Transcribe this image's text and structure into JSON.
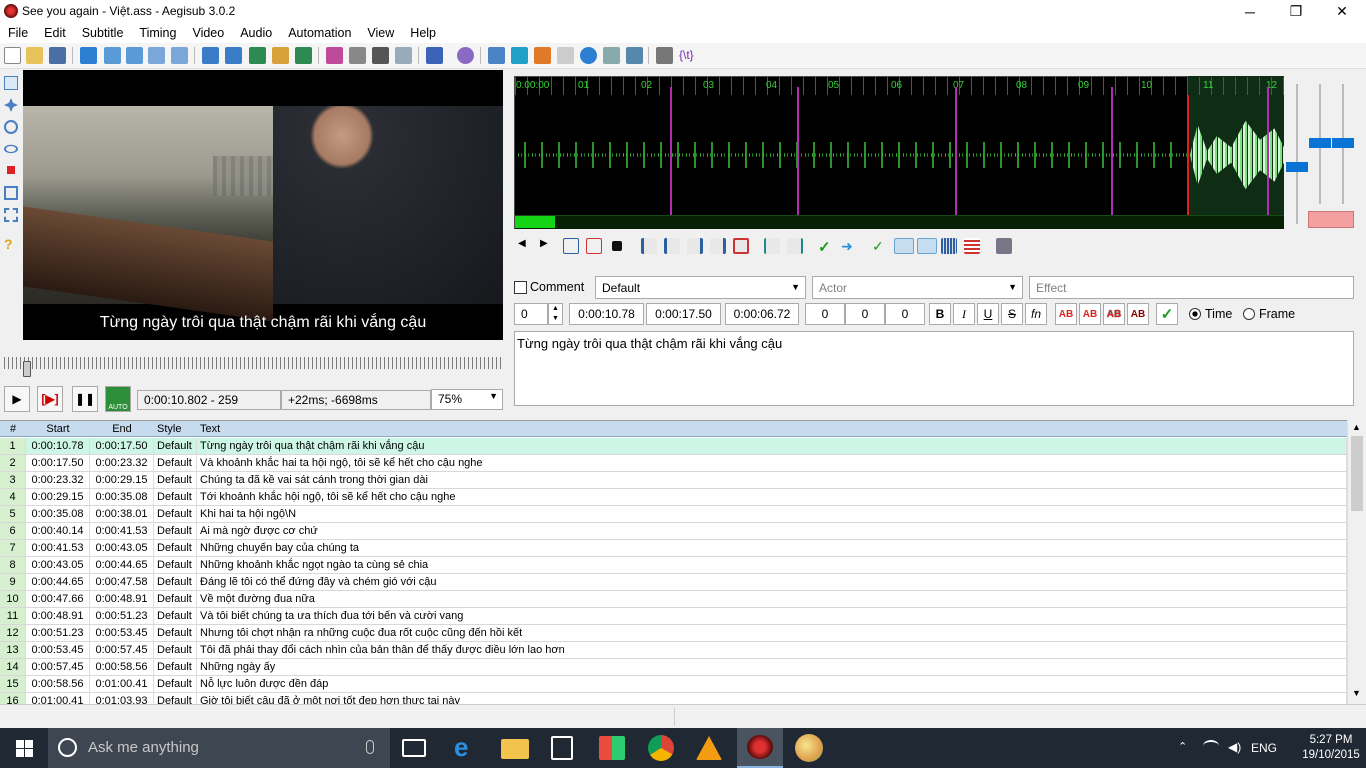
{
  "window": {
    "title": "See you again - Việt.ass - Aegisub 3.0.2",
    "minimize_glyph": "─",
    "maximize_glyph": "❐",
    "close_glyph": "✕"
  },
  "menu": [
    "File",
    "Edit",
    "Subtitle",
    "Timing",
    "Video",
    "Audio",
    "Automation",
    "View",
    "Help"
  ],
  "video": {
    "subtitle_overlay": "Từng ngày trôi qua thật chậm rãi khi vắng cậu",
    "time_display": "0:00:10.802 - 259",
    "offset_display": "+22ms; -6698ms",
    "zoom": "75%",
    "play_glyph": "▶",
    "play_line_glyph": "[▶]",
    "pause_glyph": "❚❚",
    "auto_label": "AUTO"
  },
  "audio": {
    "ticks": [
      "0:00:00",
      "01",
      "02",
      "03",
      "04",
      "05",
      "06",
      "07",
      "08",
      "09",
      "10",
      "11",
      "12"
    ]
  },
  "edit": {
    "comment_label": "Comment",
    "style": "Default",
    "actor_placeholder": "Actor",
    "effect_placeholder": "Effect",
    "layer": "0",
    "start_time": "0:00:10.78",
    "end_time": "0:00:17.50",
    "duration": "0:00:06.72",
    "margin_l": "0",
    "margin_r": "0",
    "margin_v": "0",
    "bold": "B",
    "italic": "I",
    "underline": "U",
    "strike": "S",
    "fn": "fn",
    "color_labels": [
      "AB",
      "AB",
      "AB",
      "AB"
    ],
    "time_label": "Time",
    "frame_label": "Frame",
    "text": "Từng ngày trôi qua thật chậm rãi khi vắng cậu"
  },
  "grid": {
    "headers": [
      "#",
      "Start",
      "End",
      "Style",
      "Text"
    ],
    "rows": [
      [
        "1",
        "0:00:10.78",
        "0:00:17.50",
        "Default",
        "Từng ngày trôi qua thật chậm rãi khi vắng cậu"
      ],
      [
        "2",
        "0:00:17.50",
        "0:00:23.32",
        "Default",
        "Và khoảnh khắc hai ta hội ngộ, tôi sẽ kể hết cho cậu nghe"
      ],
      [
        "3",
        "0:00:23.32",
        "0:00:29.15",
        "Default",
        "Chúng ta đã kề vai sát cánh trong thời gian dài"
      ],
      [
        "4",
        "0:00:29.15",
        "0:00:35.08",
        "Default",
        "Tới khoảnh khắc hội ngộ, tôi sẽ kể hết cho cậu nghe"
      ],
      [
        "5",
        "0:00:35.08",
        "0:00:38.01",
        "Default",
        "Khi hai ta hội ngộ\\N"
      ],
      [
        "6",
        "0:00:40.14",
        "0:00:41.53",
        "Default",
        "Ai mà ngờ được cơ chứ"
      ],
      [
        "7",
        "0:00:41.53",
        "0:00:43.05",
        "Default",
        "Những chuyến bay của chúng ta"
      ],
      [
        "8",
        "0:00:43.05",
        "0:00:44.65",
        "Default",
        "Những khoảnh khắc ngọt ngào ta cùng sẻ chia"
      ],
      [
        "9",
        "0:00:44.65",
        "0:00:47.58",
        "Default",
        "Đáng lẽ tôi có thể đứng đây và chém gió với cậu"
      ],
      [
        "10",
        "0:00:47.66",
        "0:00:48.91",
        "Default",
        "Về một đường đua nữa"
      ],
      [
        "11",
        "0:00:48.91",
        "0:00:51.23",
        "Default",
        "Và tôi biết chúng ta ưa thích đua tới bến và cười vang"
      ],
      [
        "12",
        "0:00:51.23",
        "0:00:53.45",
        "Default",
        "Nhưng tôi chợt nhận ra những cuộc đua rốt cuộc cũng đến hồi kết"
      ],
      [
        "13",
        "0:00:53.45",
        "0:00:57.45",
        "Default",
        "Tôi đã phải thay đổi cách nhìn của bản thân để thấy được điều lớn lao hơn"
      ],
      [
        "14",
        "0:00:57.45",
        "0:00:58.56",
        "Default",
        "Những ngày ấy"
      ],
      [
        "15",
        "0:00:58.56",
        "0:01:00.41",
        "Default",
        "Nỗ lực luôn được đền đáp"
      ],
      [
        "16",
        "0:01:00.41",
        "0:01:03.93",
        "Default",
        "Giờ tôi biết cậu đã ở một nơi tốt đẹp hơn thực tại này"
      ]
    ]
  },
  "taskbar": {
    "search_placeholder": "Ask me anything",
    "language": "ENG",
    "time": "5:27 PM",
    "date": "19/10/2015"
  }
}
